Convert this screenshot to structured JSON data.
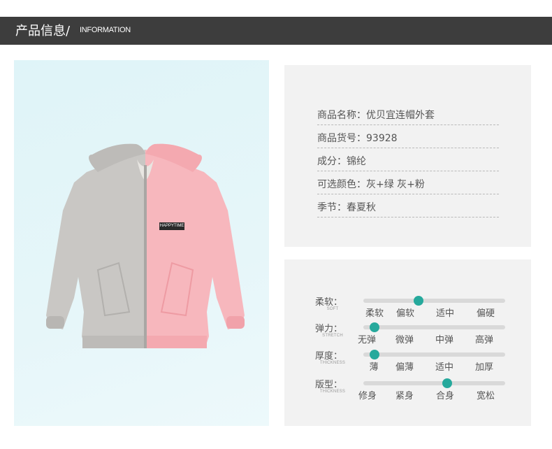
{
  "header": {
    "title": "产品信息/",
    "subtitle": "INFORMATION"
  },
  "product": {
    "image_alt": "hooded jacket",
    "badge_text": "HAPPYTIME",
    "info": [
      {
        "label": "商品名称：",
        "value": "优贝宜连帽外套"
      },
      {
        "label": "商品货号：",
        "value": "93928"
      },
      {
        "label": "成分：",
        "value": "锦纶"
      },
      {
        "label": "可选颜色：",
        "value": "灰+绿  灰+粉"
      },
      {
        "label": "季节：",
        "value": "春夏秋"
      }
    ]
  },
  "attributes": [
    {
      "label": "柔软：",
      "label_en": "SOFT",
      "options": [
        "柔软",
        "偏软",
        "适中",
        "偏硬"
      ],
      "level": 0.39
    },
    {
      "label": "弹力：",
      "label_en": "STRETCH",
      "options": [
        "无弹",
        "微弹",
        "中弹",
        "高弹"
      ],
      "level": 0.08
    },
    {
      "label": "厚度：",
      "label_en": "THICKNESS",
      "options": [
        "薄",
        "偏薄",
        "适中",
        "加厚"
      ],
      "level": 0.08
    },
    {
      "label": "版型：",
      "label_en": "THICKNESS",
      "options": [
        "修身",
        "紧身",
        "合身",
        "宽松"
      ],
      "level": 0.59
    }
  ],
  "colors": {
    "header_bg": "#3d3d3d",
    "accent": "#26a99c",
    "card_bg": "#f2f2f2",
    "jacket_grey": "#c9c7c4",
    "jacket_pink": "#f7b7bd"
  }
}
